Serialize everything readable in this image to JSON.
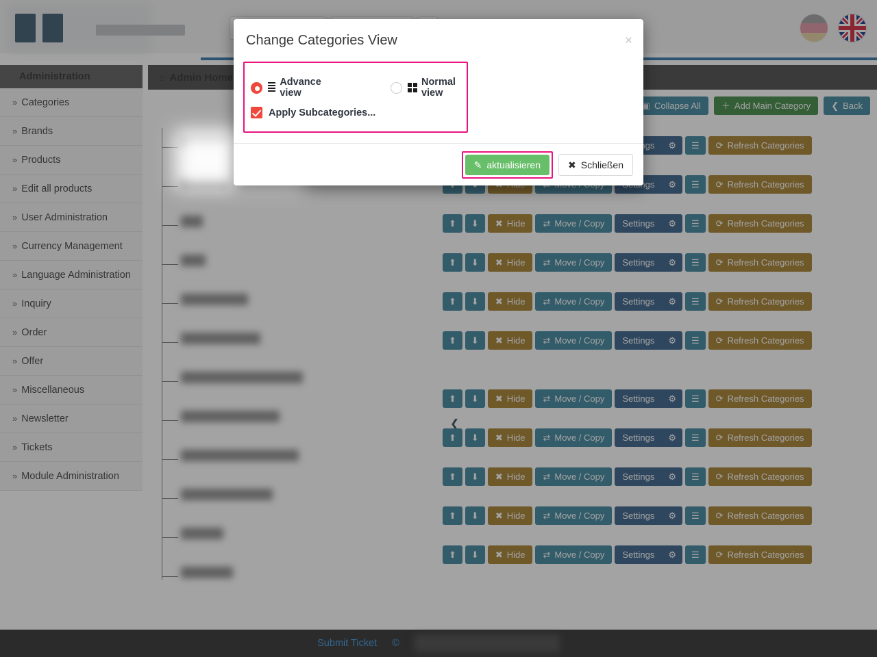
{
  "header": {
    "fields": [
      "",
      "",
      ""
    ],
    "flags": [
      {
        "name": "flag-de",
        "title": "Deutsch",
        "active": false
      },
      {
        "name": "flag-en",
        "title": "English",
        "active": true
      }
    ]
  },
  "sidebar": {
    "title": "Administration",
    "chevron": "»",
    "items": [
      {
        "label": "Categories"
      },
      {
        "label": "Brands"
      },
      {
        "label": "Products"
      },
      {
        "label": "Edit all products"
      },
      {
        "label": "User Administration"
      },
      {
        "label": "Currency Management"
      },
      {
        "label": "Language Administration"
      },
      {
        "label": "Inquiry"
      },
      {
        "label": "Order"
      },
      {
        "label": "Offer"
      },
      {
        "label": "Miscellaneous"
      },
      {
        "label": "Newsletter"
      },
      {
        "label": "Tickets"
      },
      {
        "label": "Module Administration"
      }
    ]
  },
  "breadcrumb": {
    "home_icon": "⌂",
    "label": "Admin Home"
  },
  "toolbar": {
    "collapse_all": "Collapse All",
    "add_main_category": "Add Main Category",
    "back": "Back",
    "collapse_icon": "▣",
    "plus_icon": "＋",
    "back_icon": "❮"
  },
  "row_actions": {
    "up_icon": "⬆",
    "down_icon": "⬇",
    "hide": "Hide",
    "hide_icon": "✖",
    "move_copy": "Move / Copy",
    "move_icon": "⇄",
    "settings": "Settings",
    "gear_icon": "⚙",
    "list_icon": "☰",
    "refresh": "Refresh Categories",
    "refresh_icon": "⟳"
  },
  "tree": {
    "collapse_handle_icon": "❮"
  },
  "modal": {
    "title": "Change Categories View",
    "close_icon": "×",
    "options": [
      {
        "label": "Advance view",
        "icon": "lines-icon",
        "selected": true
      },
      {
        "label": "Normal view",
        "icon": "grid-icon",
        "selected": false
      }
    ],
    "checkbox": {
      "label": "Apply Subcategories...",
      "checked": true
    },
    "update_button": {
      "label": "aktualisieren",
      "icon": "edit-square-icon"
    },
    "close_button": {
      "label": "Schließen",
      "icon": "x-icon"
    }
  },
  "footer": {
    "submit_ticket": "Submit Ticket",
    "tail": "©"
  },
  "colors": {
    "accent_blue": "#1b68a7",
    "highlight_pink": "#e8137e",
    "radio_red": "#f0483c",
    "green": "#68bf6a",
    "teal": "#2c7a93",
    "gold": "#9e7319",
    "navy": "#25527e",
    "dark_green": "#2f7d32"
  }
}
